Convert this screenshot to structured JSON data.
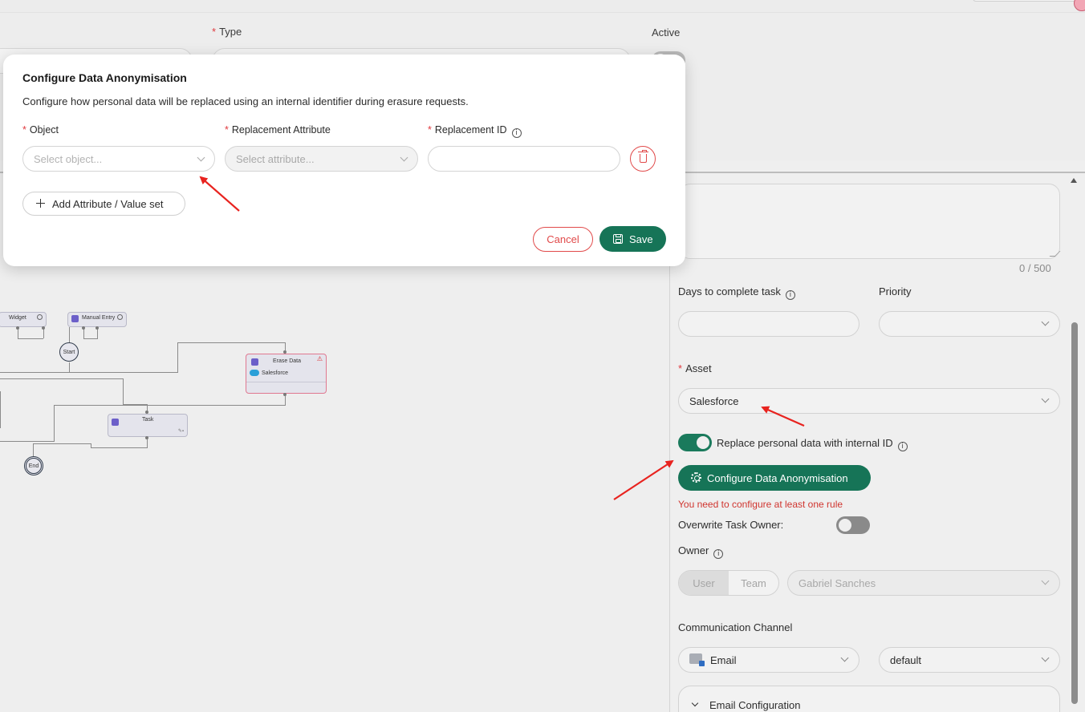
{
  "background_form": {
    "type_label": "Type",
    "active_label": "Active"
  },
  "workflow": {
    "nodes": {
      "widget": "Widget",
      "manual_entry": "Manual Entry",
      "start": "Start",
      "erase_data": "Erase Data",
      "erase_data_sub": "Salesforce",
      "task": "Task",
      "end": "End"
    }
  },
  "panel": {
    "description_counter": "0 / 500",
    "days_label": "Days to complete task",
    "priority_label": "Priority",
    "asset_label": "Asset",
    "asset_value": "Salesforce",
    "replace_toggle_label": "Replace personal data with internal ID",
    "configure_button": "Configure Data Anonymisation",
    "error_text": "You need to configure at least one rule",
    "overwrite_label": "Overwrite Task Owner:",
    "owner_label": "Owner",
    "owner_tabs": [
      "User",
      "Team"
    ],
    "owner_value": "Gabriel Sanches",
    "comm_label": "Communication Channel",
    "comm_value": "Email",
    "comm_template": "default",
    "email_config_label": "Email Configuration"
  },
  "modal": {
    "title": "Configure Data Anonymisation",
    "description": "Configure how personal data will be replaced using an internal identifier during erasure requests.",
    "object_label": "Object",
    "object_placeholder": "Select object...",
    "replacement_attr_label": "Replacement Attribute",
    "replacement_attr_placeholder": "Select attribute...",
    "replacement_id_label": "Replacement ID",
    "replacement_id_value": "",
    "add_button": "Add Attribute / Value set",
    "cancel_button": "Cancel",
    "save_button": "Save"
  },
  "colors": {
    "primary": "#167457",
    "danger": "#e14a4a",
    "annotation_arrow": "#e8231f"
  }
}
